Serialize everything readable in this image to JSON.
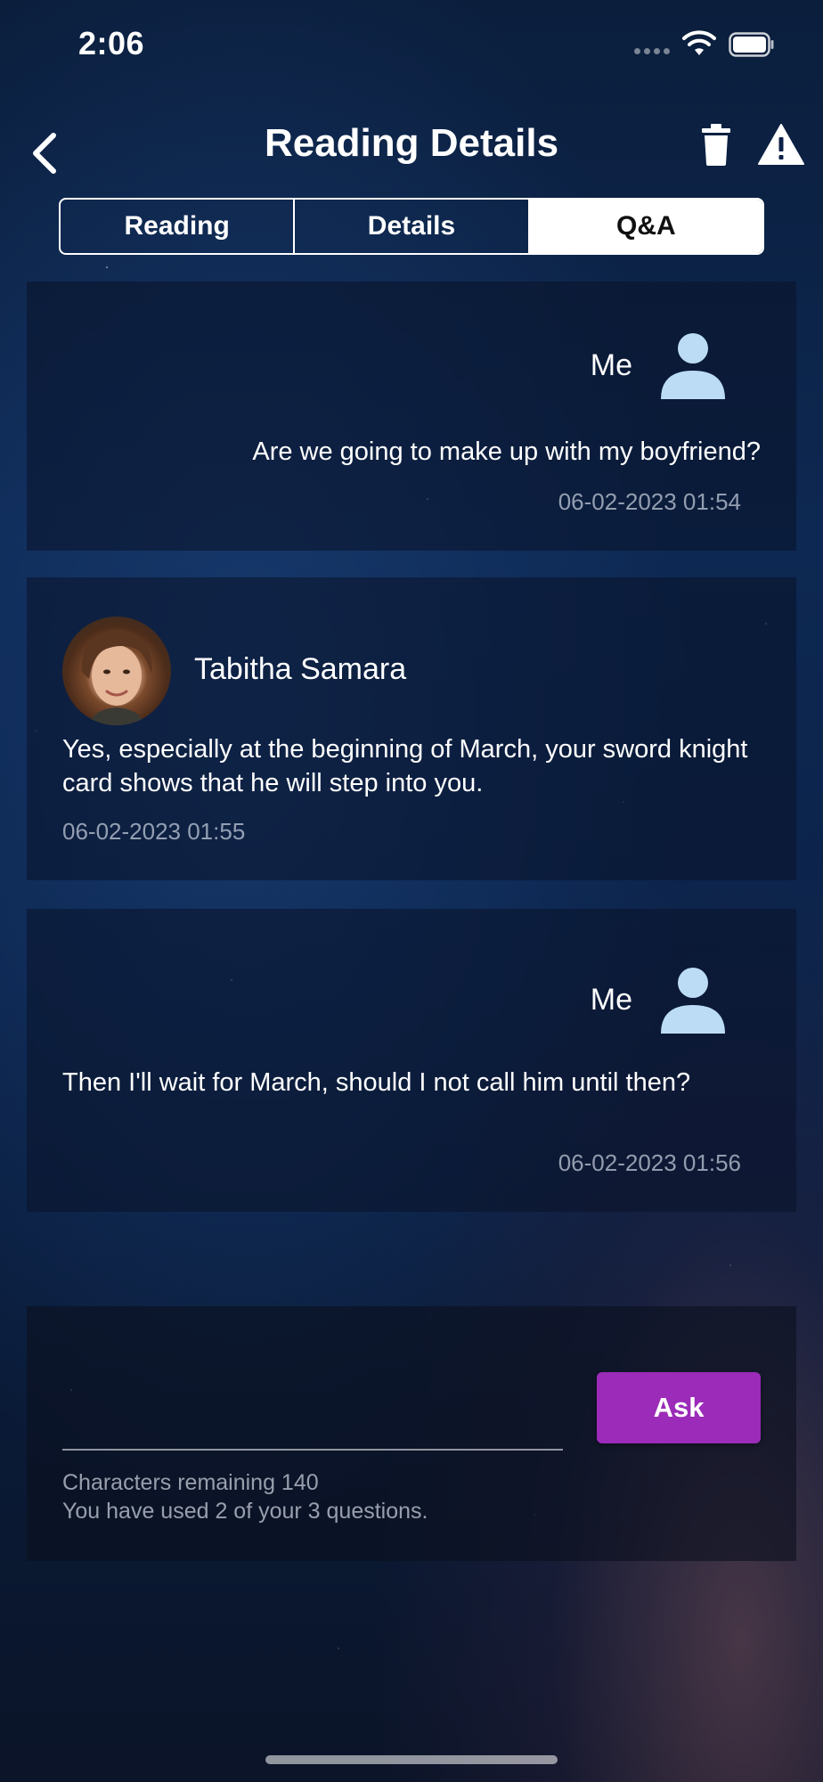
{
  "status_bar": {
    "time": "2:06"
  },
  "header": {
    "title": "Reading Details"
  },
  "tabs": [
    {
      "label": "Reading",
      "active": false
    },
    {
      "label": "Details",
      "active": false
    },
    {
      "label": "Q&A",
      "active": true
    }
  ],
  "messages": [
    {
      "sender": "Me",
      "text": "Are we going to make up with my boyfriend?",
      "time": "06-02-2023 01:54",
      "icon": "person-icon"
    },
    {
      "sender": "Tabitha Samara",
      "text": "Yes, especially at the beginning of March, your sword knight card shows that he will step into you.",
      "time": "06-02-2023 01:55",
      "icon": "avatar"
    },
    {
      "sender": "Me",
      "text": "Then I'll wait for March, should I not call him until then?",
      "time": "06-02-2023 01:56",
      "icon": "person-icon"
    }
  ],
  "ask": {
    "input_value": "",
    "button_label": "Ask",
    "chars_remaining": "Characters remaining 140",
    "questions_used": "You have used 2 of your 3 questions."
  },
  "colors": {
    "accent_button": "#9b2bb8",
    "person_icon": "#bcdcf6",
    "timestamp": "#c8d0de"
  }
}
